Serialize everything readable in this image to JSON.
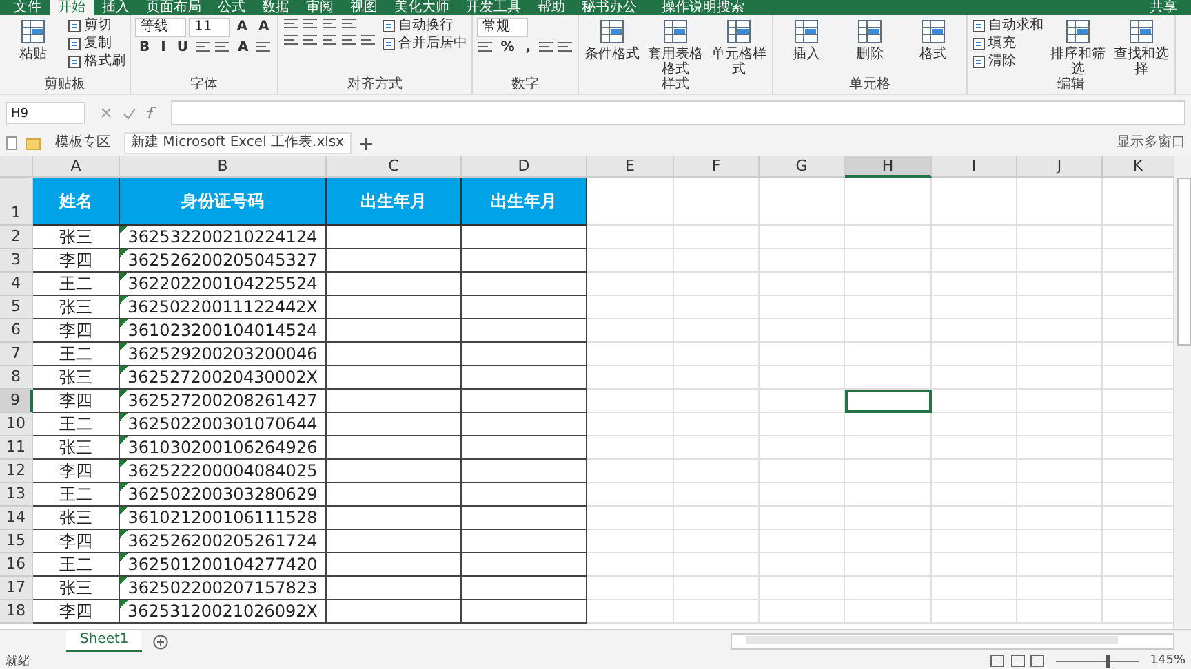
{
  "menu_tabs": [
    {
      "label": "文件",
      "selected": false
    },
    {
      "label": "开始",
      "selected": true
    },
    {
      "label": "插入",
      "selected": false
    },
    {
      "label": "页面布局",
      "selected": false
    },
    {
      "label": "公式",
      "selected": false
    },
    {
      "label": "数据",
      "selected": false
    },
    {
      "label": "审阅",
      "selected": false
    },
    {
      "label": "视图",
      "selected": false
    },
    {
      "label": "美化大师",
      "selected": false
    },
    {
      "label": "开发工具",
      "selected": false
    },
    {
      "label": "帮助",
      "selected": false
    },
    {
      "label": "秘书办公",
      "selected": false
    }
  ],
  "tell_me": "操作说明搜索",
  "share": "共享",
  "ribbon": [
    {
      "label": "剪贴板",
      "columns": [
        [
          [
            {
              "kind": "large",
              "label": "粘贴"
            }
          ]
        ],
        [
          [
            {
              "kind": "small",
              "label": "剪切"
            }
          ],
          [
            {
              "kind": "small",
              "label": "复制"
            }
          ],
          [
            {
              "kind": "small",
              "label": "格式刷"
            }
          ]
        ]
      ]
    },
    {
      "label": "字体",
      "columns": [
        [
          [
            {
              "kind": "field",
              "label": "等线"
            },
            {
              "kind": "field",
              "label": "11"
            },
            {
              "kind": "glyph",
              "label": "A"
            },
            {
              "kind": "glyph",
              "label": "A"
            }
          ],
          [
            {
              "kind": "glyph",
              "label": "B"
            },
            {
              "kind": "glyph",
              "label": "I"
            },
            {
              "kind": "glyph",
              "label": "U"
            },
            {
              "kind": "icon"
            },
            {
              "kind": "icon"
            },
            {
              "kind": "glyph",
              "label": "A"
            },
            {
              "kind": "icon"
            }
          ]
        ]
      ]
    },
    {
      "label": "对齐方式",
      "columns": [
        [
          [
            {
              "kind": "icon"
            },
            {
              "kind": "icon"
            },
            {
              "kind": "icon"
            },
            {
              "kind": "icon"
            }
          ],
          [
            {
              "kind": "icon"
            },
            {
              "kind": "icon"
            },
            {
              "kind": "icon"
            },
            {
              "kind": "icon"
            },
            {
              "kind": "icon"
            }
          ]
        ],
        [
          [
            {
              "kind": "small",
              "label": "自动换行"
            }
          ],
          [
            {
              "kind": "small",
              "label": "合并后居中"
            }
          ]
        ]
      ]
    },
    {
      "label": "数字",
      "columns": [
        [
          [
            {
              "kind": "field",
              "label": "常规"
            }
          ],
          [
            {
              "kind": "icon"
            },
            {
              "kind": "glyph",
              "label": "%"
            },
            {
              "kind": "glyph",
              "label": ","
            },
            {
              "kind": "icon"
            },
            {
              "kind": "icon"
            }
          ]
        ]
      ]
    },
    {
      "label": "样式",
      "columns": [
        [
          [
            {
              "kind": "large",
              "label": "条件格式"
            }
          ]
        ],
        [
          [
            {
              "kind": "large",
              "label": "套用表格格式"
            }
          ]
        ],
        [
          [
            {
              "kind": "large",
              "label": "单元格样式"
            }
          ]
        ]
      ]
    },
    {
      "label": "单元格",
      "columns": [
        [
          [
            {
              "kind": "large",
              "label": "插入"
            }
          ]
        ],
        [
          [
            {
              "kind": "large",
              "label": "删除"
            }
          ]
        ],
        [
          [
            {
              "kind": "large",
              "label": "格式"
            }
          ]
        ]
      ]
    },
    {
      "label": "编辑",
      "columns": [
        [
          [
            {
              "kind": "small",
              "label": "自动求和"
            }
          ],
          [
            {
              "kind": "small",
              "label": "填充"
            }
          ],
          [
            {
              "kind": "small",
              "label": "清除"
            }
          ]
        ],
        [
          [
            {
              "kind": "large",
              "label": "排序和筛选"
            }
          ]
        ],
        [
          [
            {
              "kind": "large",
              "label": "查找和选择"
            }
          ]
        ]
      ]
    }
  ],
  "name_box": "H9",
  "file_tabs": [
    {
      "label": "模板专区",
      "selected": false
    },
    {
      "label": "新建 Microsoft Excel 工作表.xlsx",
      "selected": true
    }
  ],
  "multi_window": "显示多窗口",
  "columns": [
    {
      "label": "A",
      "selected": false
    },
    {
      "label": "B",
      "selected": false
    },
    {
      "label": "C",
      "selected": false
    },
    {
      "label": "D",
      "selected": false
    },
    {
      "label": "E",
      "selected": false
    },
    {
      "label": "F",
      "selected": false
    },
    {
      "label": "G",
      "selected": false
    },
    {
      "label": "H",
      "selected": true
    },
    {
      "label": "I",
      "selected": false
    },
    {
      "label": "J",
      "selected": false
    },
    {
      "label": "K",
      "selected": false
    }
  ],
  "header_row": {
    "number": "1",
    "cells": [
      "姓名",
      "身份证号码",
      "出生年月",
      "出生年月"
    ]
  },
  "rows": [
    {
      "number": "2",
      "name": "张三",
      "id": "362532200210224124",
      "selected": false
    },
    {
      "number": "3",
      "name": "李四",
      "id": "362526200205045327",
      "selected": false
    },
    {
      "number": "4",
      "name": "王二",
      "id": "362202200104225524",
      "selected": false
    },
    {
      "number": "5",
      "name": "张三",
      "id": "36250220011122442X",
      "selected": false
    },
    {
      "number": "6",
      "name": "李四",
      "id": "361023200104014524",
      "selected": false
    },
    {
      "number": "7",
      "name": "王二",
      "id": "362529200203200046",
      "selected": false
    },
    {
      "number": "8",
      "name": "张三",
      "id": "36252720020430002X",
      "selected": false
    },
    {
      "number": "9",
      "name": "李四",
      "id": "362527200208261427",
      "selected": true
    },
    {
      "number": "10",
      "name": "王二",
      "id": "362502200301070644",
      "selected": false
    },
    {
      "number": "11",
      "name": "张三",
      "id": "361030200106264926",
      "selected": false
    },
    {
      "number": "12",
      "name": "李四",
      "id": "362522200004084025",
      "selected": false
    },
    {
      "number": "13",
      "name": "王二",
      "id": "362502200303280629",
      "selected": false
    },
    {
      "number": "14",
      "name": "张三",
      "id": "361021200106111528",
      "selected": false
    },
    {
      "number": "15",
      "name": "李四",
      "id": "362526200205261724",
      "selected": false
    },
    {
      "number": "16",
      "name": "王二",
      "id": "362501200104277420",
      "selected": false
    },
    {
      "number": "17",
      "name": "张三",
      "id": "362502200207157823",
      "selected": false
    },
    {
      "number": "18",
      "name": "李四",
      "id": "36253120021026092X",
      "selected": false
    }
  ],
  "sheets": [
    {
      "label": "Sheet1",
      "selected": true
    }
  ],
  "status": "就绪",
  "zoom": "145%",
  "zoom_slider": {
    "level": 0.62
  }
}
